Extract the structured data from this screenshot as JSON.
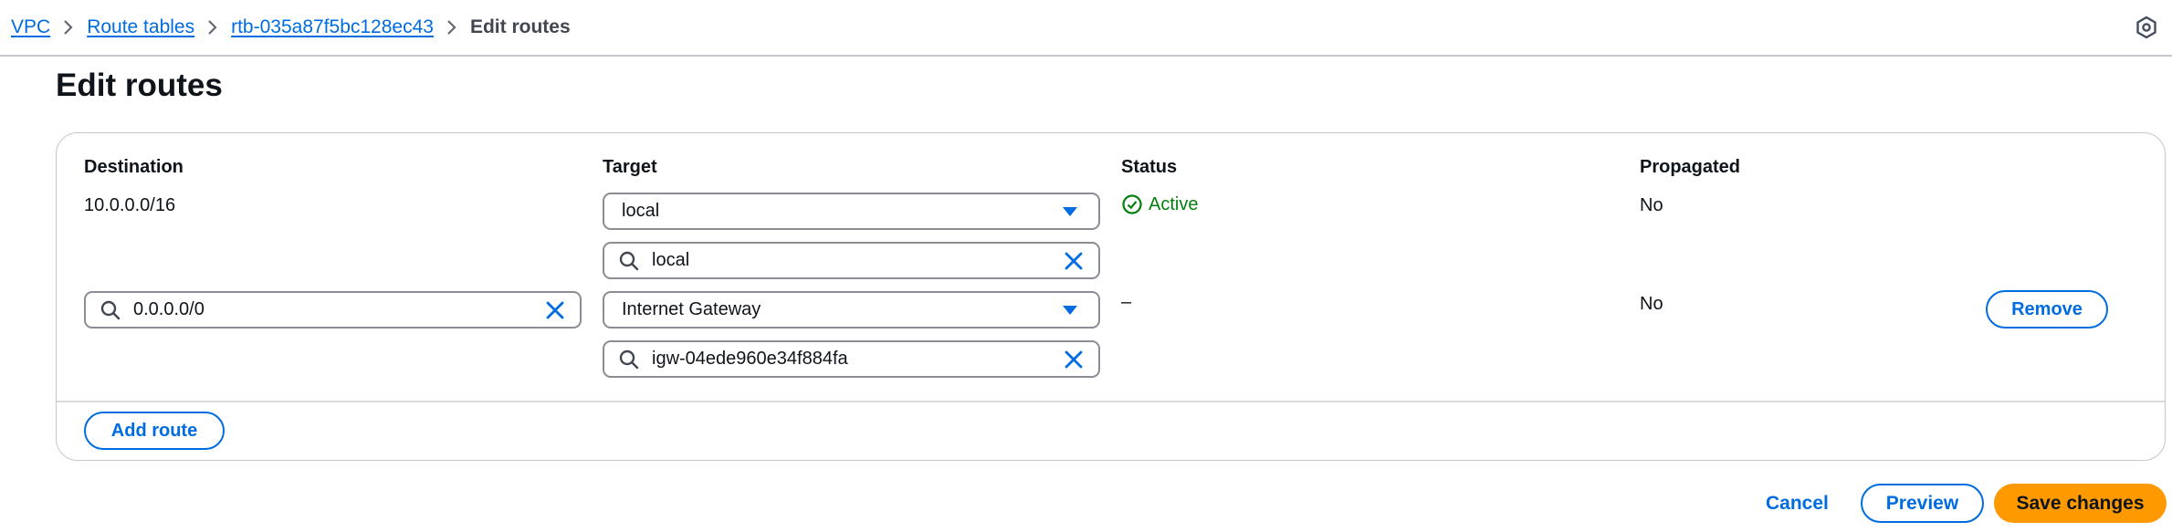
{
  "breadcrumb": {
    "items": [
      "VPC",
      "Route tables",
      "rtb-035a87f5bc128ec43"
    ],
    "current": "Edit routes"
  },
  "page_title": "Edit routes",
  "table": {
    "headers": {
      "destination": "Destination",
      "target": "Target",
      "status": "Status",
      "propagated": "Propagated"
    },
    "rows": [
      {
        "destination": "10.0.0.0/16",
        "target_select": "local",
        "target_filter": "local",
        "status": "Active",
        "propagated": "No"
      },
      {
        "destination": "0.0.0.0/0",
        "target_select": "Internet Gateway",
        "target_filter": "igw-04ede960e34f884fa",
        "status": "–",
        "propagated": "No",
        "remove_label": "Remove"
      }
    ]
  },
  "add_route_label": "Add route",
  "footer": {
    "cancel_label": "Cancel",
    "preview_label": "Preview",
    "save_label": "Save changes"
  },
  "icons": {
    "help": "help-circle-icon",
    "search": "search-icon",
    "clear": "close-icon",
    "dropdown": "caret-down-icon",
    "status_ok": "check-circle-icon"
  },
  "colors": {
    "link": "#006ce0",
    "success": "#037f0c",
    "primary_button": "#ff9900",
    "border": "#8c8c94"
  }
}
